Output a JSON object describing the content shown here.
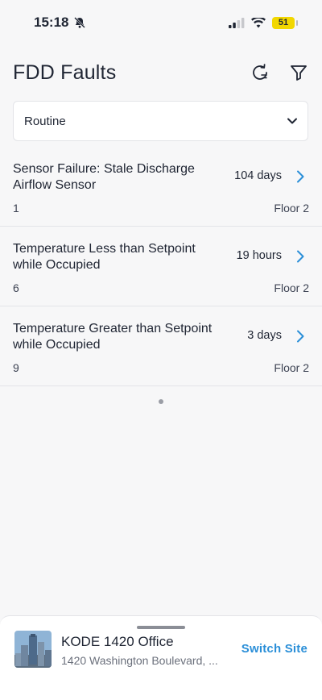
{
  "status_bar": {
    "time": "15:18",
    "battery": "51",
    "icons": [
      "bell-slash-icon",
      "cellular-icon",
      "wifi-icon",
      "battery-icon"
    ]
  },
  "header": {
    "title": "FDD Faults",
    "actions": [
      "refresh-icon",
      "filter-icon"
    ]
  },
  "filter": {
    "selected": "Routine"
  },
  "faults": [
    {
      "title": "Sensor Failure: Stale Discharge Airflow Sensor",
      "age": "104 days",
      "count": "1",
      "floor": "Floor 2"
    },
    {
      "title": "Temperature Less than Setpoint while Occupied",
      "age": "19 hours",
      "count": "6",
      "floor": "Floor 2"
    },
    {
      "title": "Temperature Greater than Setpoint while Occupied",
      "age": "3 days",
      "count": "9",
      "floor": "Floor 2"
    }
  ],
  "site": {
    "name": "KODE 1420 Office",
    "address": "1420 Washington Boulevard, ...",
    "switch_label": "Switch Site"
  },
  "colors": {
    "accent": "#2b8fd8",
    "text": "#1f2533",
    "background": "#f7f7f8"
  }
}
